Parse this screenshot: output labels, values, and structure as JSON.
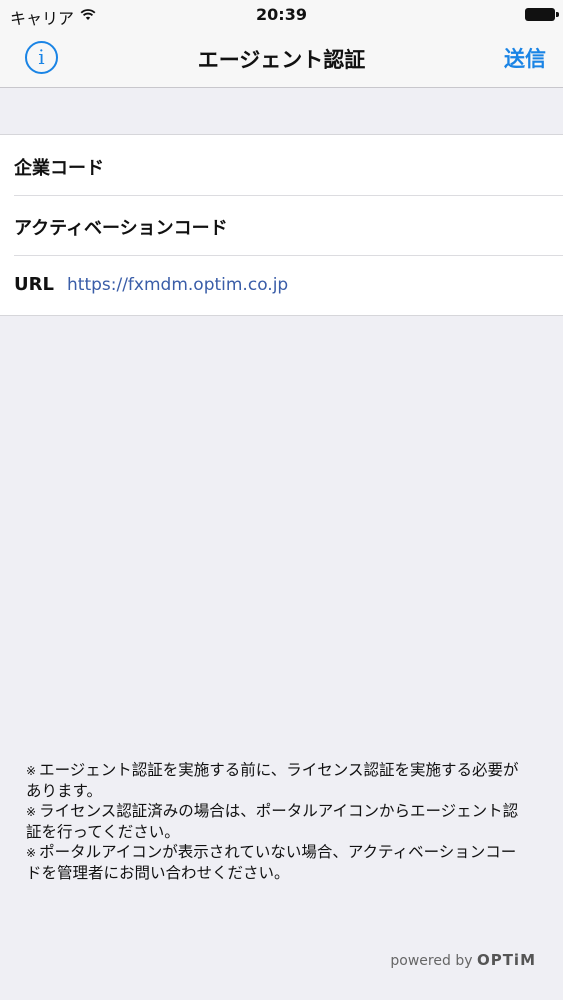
{
  "status_bar": {
    "carrier": "キャリア",
    "time": "20:39"
  },
  "nav": {
    "title": "エージェント認証",
    "info_label": "i",
    "send_label": "送信"
  },
  "form": {
    "rows": [
      {
        "label": "企業コード",
        "value": ""
      },
      {
        "label": "アクティベーションコード",
        "value": ""
      },
      {
        "label": "URL",
        "value": "https://fxmdm.optim.co.jp"
      }
    ]
  },
  "notes": [
    {
      "mark": "※",
      "text": "エージェント認証を実施する前に、ライセンス認証を実施する必要があります。"
    },
    {
      "mark": "※",
      "text": "ライセンス認証済みの場合は、ポータルアイコンからエージェント認証を行ってください。"
    },
    {
      "mark": "※",
      "text": "ポータルアイコンが表示されていない場合、アクティベーションコードを管理者にお問い合わせください。"
    }
  ],
  "footer": {
    "powered_by": "powered by",
    "brand": "OPTiM"
  },
  "colors": {
    "accent": "#1a84e5",
    "link": "#3a5da8",
    "background": "#efeff4"
  }
}
